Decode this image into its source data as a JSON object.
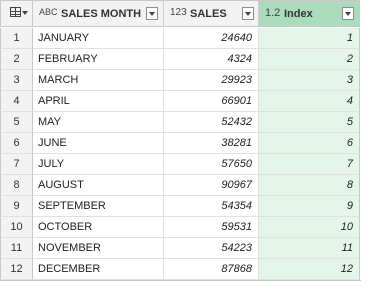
{
  "columns": {
    "month": {
      "type_icon": "ABC",
      "label": "SALES MONTH"
    },
    "sales": {
      "type_icon": "123",
      "label": "SALES"
    },
    "index": {
      "type_icon": "1.2",
      "label": "Index"
    }
  },
  "rows": [
    {
      "n": "1",
      "month": "JANUARY",
      "sales": "24640",
      "index": "1"
    },
    {
      "n": "2",
      "month": "FEBRUARY",
      "sales": "4324",
      "index": "2"
    },
    {
      "n": "3",
      "month": "MARCH",
      "sales": "29923",
      "index": "3"
    },
    {
      "n": "4",
      "month": "APRIL",
      "sales": "66901",
      "index": "4"
    },
    {
      "n": "5",
      "month": "MAY",
      "sales": "52432",
      "index": "5"
    },
    {
      "n": "6",
      "month": "JUNE",
      "sales": "38281",
      "index": "6"
    },
    {
      "n": "7",
      "month": "JULY",
      "sales": "57650",
      "index": "7"
    },
    {
      "n": "8",
      "month": "AUGUST",
      "sales": "90967",
      "index": "8"
    },
    {
      "n": "9",
      "month": "SEPTEMBER",
      "sales": "54354",
      "index": "9"
    },
    {
      "n": "10",
      "month": "OCTOBER",
      "sales": "59531",
      "index": "10"
    },
    {
      "n": "11",
      "month": "NOVEMBER",
      "sales": "54223",
      "index": "11"
    },
    {
      "n": "12",
      "month": "DECEMBER",
      "sales": "87868",
      "index": "12"
    }
  ],
  "colors": {
    "selected_column": "#a9dcbb",
    "selected_cells": "#e4f5e9"
  }
}
